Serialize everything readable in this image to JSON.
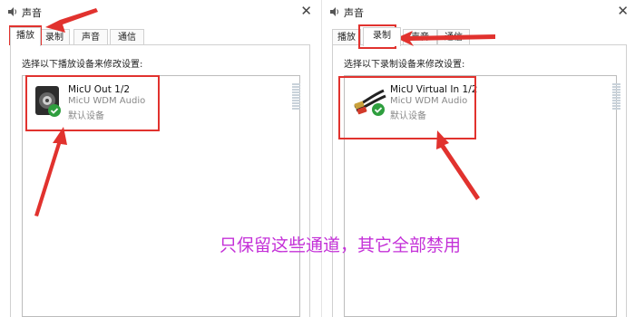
{
  "colors": {
    "annotation_red": "#e1322e",
    "caption_purple": "#c431d8",
    "check_green": "#2e9e3e"
  },
  "left_dialog": {
    "title": "声音",
    "tabs": [
      {
        "label": "播放",
        "active": true
      },
      {
        "label": "录制",
        "active": false
      },
      {
        "label": "声音",
        "active": false
      },
      {
        "label": "通信",
        "active": false
      }
    ],
    "instruction": "选择以下播放设备来修改设置:",
    "device": {
      "name": "MicU Out 1/2",
      "driver": "MicU WDM Audio",
      "status": "默认设备",
      "icon": "speaker-icon"
    }
  },
  "right_dialog": {
    "title": "声音",
    "tabs": [
      {
        "label": "播放",
        "active": false
      },
      {
        "label": "录制",
        "active": true
      },
      {
        "label": "声音",
        "active": false
      },
      {
        "label": "通信",
        "active": false
      }
    ],
    "instruction": "选择以下录制设备来修改设置:",
    "device": {
      "name": "MicU Virtual In 1/2",
      "driver": "MicU WDM Audio",
      "status": "默认设备",
      "icon": "rca-cable-icon"
    }
  },
  "caption": "只保留这些通道，其它全部禁用"
}
